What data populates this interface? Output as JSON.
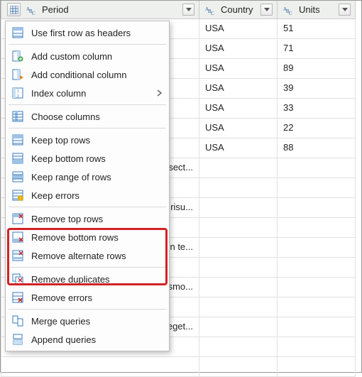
{
  "columns": [
    {
      "name": "Period",
      "type": "text"
    },
    {
      "name": "Country",
      "type": "text"
    },
    {
      "name": "Units",
      "type": "text"
    }
  ],
  "rows": [
    {
      "period": "",
      "country": "USA",
      "units": "51"
    },
    {
      "period": "",
      "country": "USA",
      "units": "71"
    },
    {
      "period": "",
      "country": "USA",
      "units": "89"
    },
    {
      "period": "",
      "country": "USA",
      "units": "39"
    },
    {
      "period": "",
      "country": "USA",
      "units": "33"
    },
    {
      "period": "",
      "country": "USA",
      "units": "22"
    },
    {
      "period": "",
      "country": "USA",
      "units": "88"
    },
    {
      "period": "onsect...",
      "country": "",
      "units": ""
    },
    {
      "period": "",
      "country": "",
      "units": ""
    },
    {
      "period": "us risu...",
      "country": "",
      "units": ""
    },
    {
      "period": "",
      "country": "",
      "units": ""
    },
    {
      "period": "din te...",
      "country": "",
      "units": ""
    },
    {
      "period": "",
      "country": "",
      "units": ""
    },
    {
      "period": "ismo...",
      "country": "",
      "units": ""
    },
    {
      "period": "",
      "country": "",
      "units": ""
    },
    {
      "period": "t eget...",
      "country": "",
      "units": ""
    },
    {
      "period": "",
      "country": "",
      "units": ""
    },
    {
      "period": "",
      "country": "",
      "units": ""
    }
  ],
  "menu": {
    "use_first_row": "Use first row as headers",
    "add_custom": "Add custom column",
    "add_cond": "Add conditional column",
    "index_col": "Index column",
    "choose_cols": "Choose columns",
    "keep_top": "Keep top rows",
    "keep_bottom": "Keep bottom rows",
    "keep_range": "Keep range of rows",
    "keep_errors": "Keep errors",
    "remove_top": "Remove top rows",
    "remove_bottom": "Remove bottom rows",
    "remove_alt": "Remove alternate rows",
    "remove_dupes": "Remove duplicates",
    "remove_errors": "Remove errors",
    "merge_q": "Merge queries",
    "append_q": "Append queries"
  }
}
